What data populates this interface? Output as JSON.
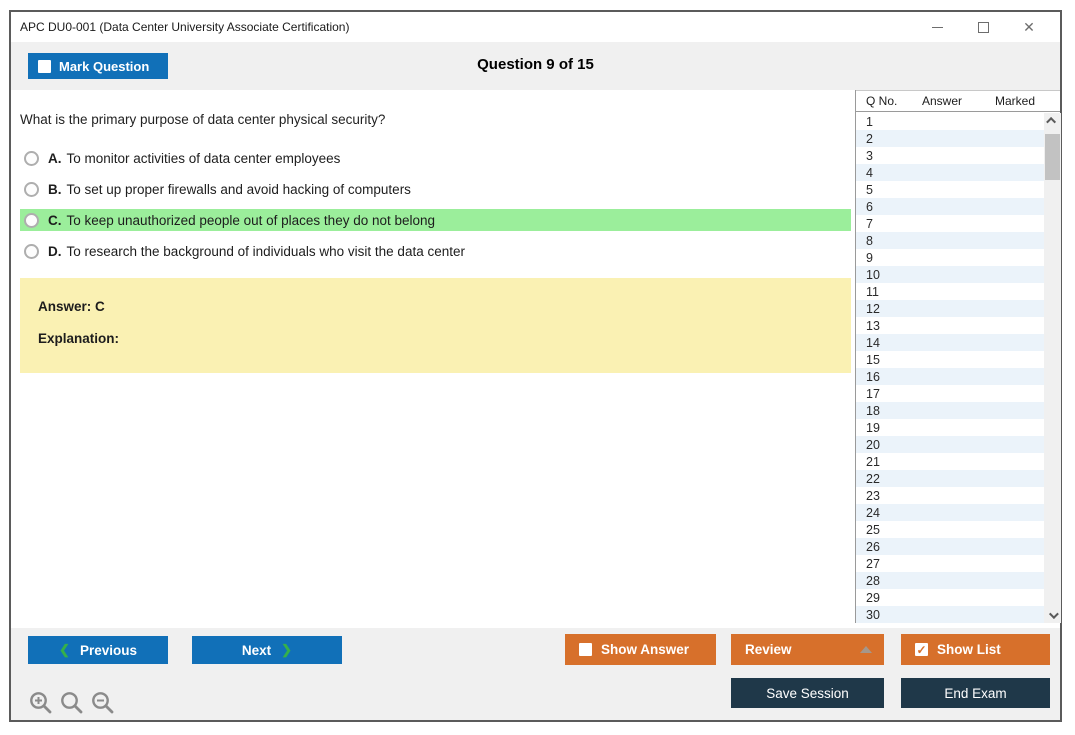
{
  "window": {
    "title": "APC DU0-001 (Data Center University Associate Certification)",
    "controls": {
      "minimize": "minimize",
      "maximize": "maximize",
      "close": "✕"
    }
  },
  "header": {
    "mark_question_label": "Mark Question",
    "question_counter": "Question 9 of 15"
  },
  "question": {
    "text": "What is the primary purpose of data center physical security?",
    "options": [
      {
        "letter": "A.",
        "text": "To monitor activities of data center employees",
        "highlighted": false
      },
      {
        "letter": "B.",
        "text": "To set up proper firewalls and avoid hacking of computers",
        "highlighted": false
      },
      {
        "letter": "C.",
        "text": "To keep unauthorized people out of places they do not belong",
        "highlighted": true
      },
      {
        "letter": "D.",
        "text": "To research the background of individuals who visit the data center",
        "highlighted": false
      }
    ]
  },
  "answer_panel": {
    "answer_label": "Answer: C",
    "explanation_label": "Explanation:"
  },
  "sidebar": {
    "columns": [
      "Q No.",
      "Answer",
      "Marked"
    ],
    "row_numbers": [
      1,
      2,
      3,
      4,
      5,
      6,
      7,
      8,
      9,
      10,
      11,
      12,
      13,
      14,
      15,
      16,
      17,
      18,
      19,
      20,
      21,
      22,
      23,
      24,
      25,
      26,
      27,
      28,
      29,
      30
    ],
    "row_answer_value": "",
    "row_marked_value": ""
  },
  "footer": {
    "previous_label": "Previous",
    "next_label": "Next",
    "prev_chevron": "❮",
    "next_chevron": "❯",
    "show_answer_label": "Show Answer",
    "review_label": "Review",
    "show_list_label": "Show List",
    "show_list_checked_glyph": "✓",
    "save_session_label": "Save Session",
    "end_exam_label": "End Exam"
  },
  "colors": {
    "accent_blue": "#1170b8",
    "accent_orange": "#d7702b",
    "dark_navy": "#1f3849",
    "highlight_green": "#9bee9b",
    "answer_panel_yellow": "#faf1b3",
    "row_alt_blue": "#ebf3fa"
  }
}
